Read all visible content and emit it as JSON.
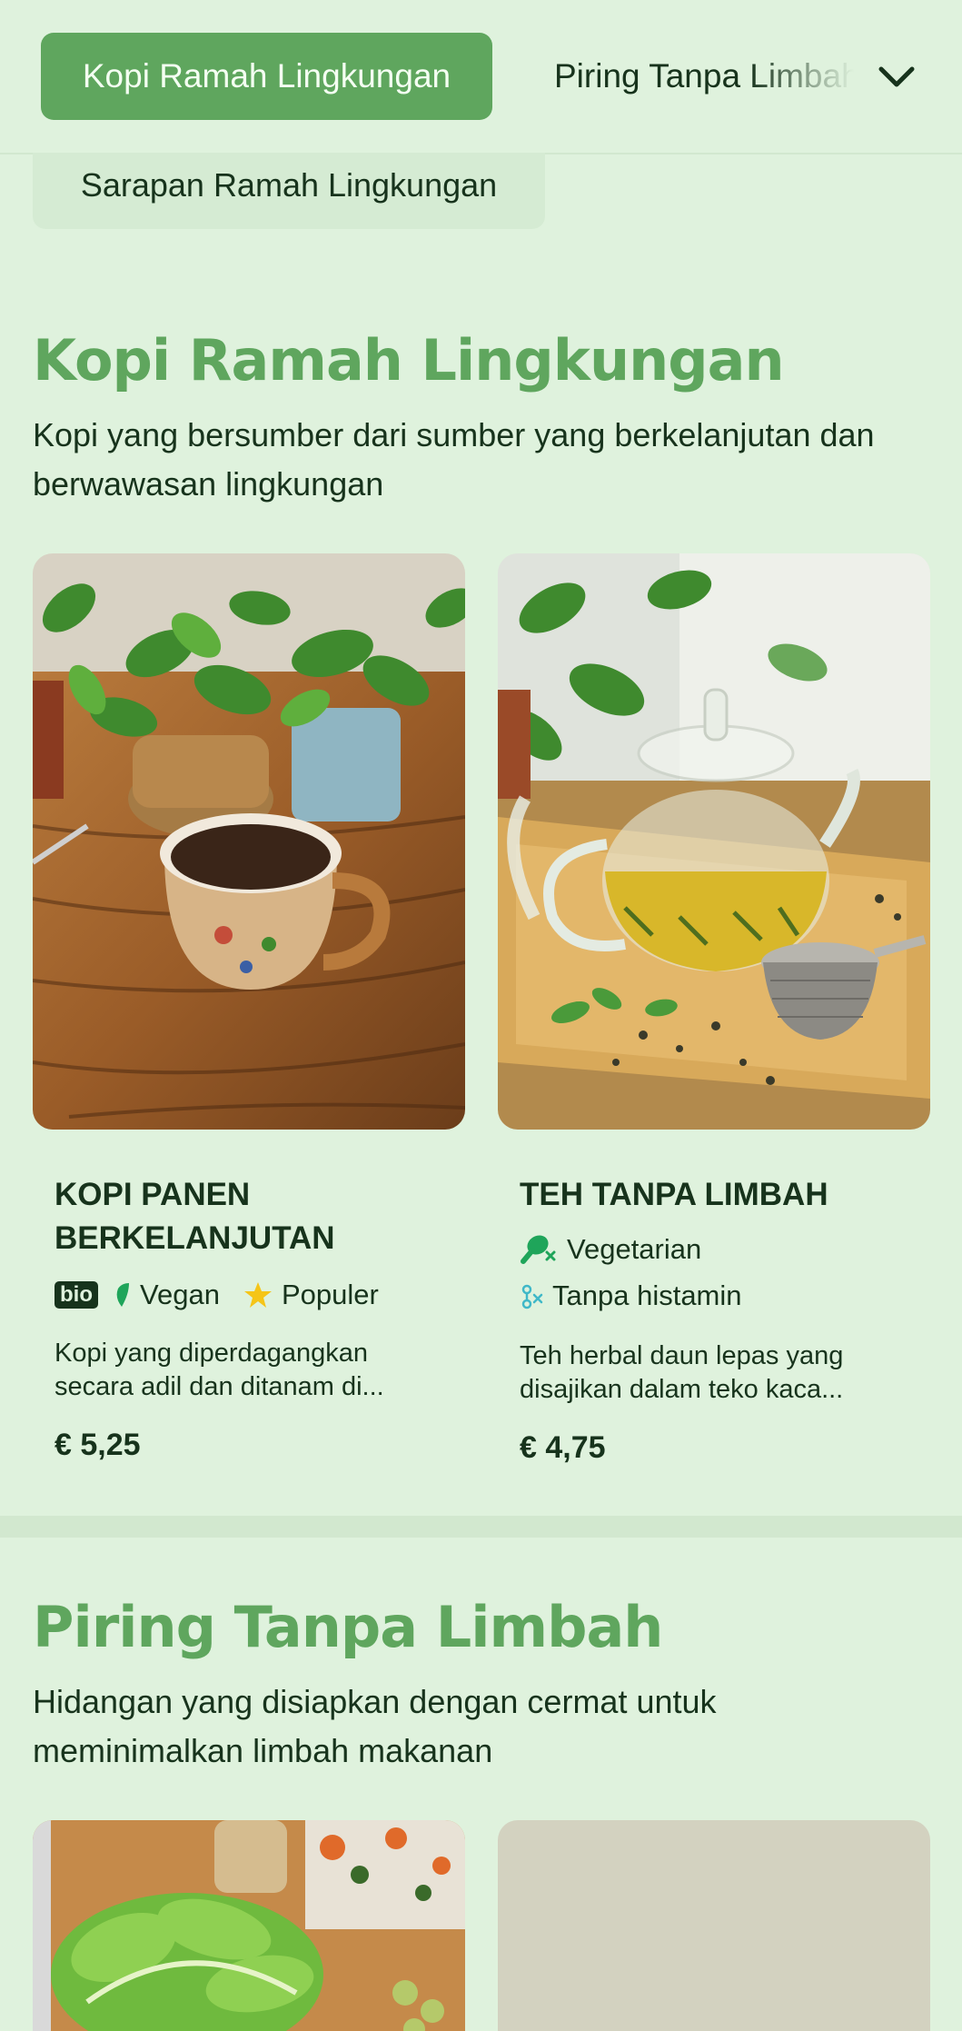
{
  "nav": {
    "active_category": "Kopi Ramah Lingkungan",
    "next_category": "Piring Tanpa Limbah",
    "sub_category": "Sarapan Ramah Lingkungan"
  },
  "sections": [
    {
      "title": "Kopi Ramah Lingkungan",
      "description": "Kopi yang bersumber dari sumber yang berkelanjutan dan berwawasan lingkungan",
      "items": [
        {
          "name": "KOPI PANEN BERKELANJUTAN",
          "badge": "bio",
          "tags": [
            "Vegan",
            "Populer"
          ],
          "description": "Kopi yang diperdagangkan secara adil dan ditanam di...",
          "price": "€ 5,25"
        },
        {
          "name": "TEH TANPA LIMBAH",
          "tags": [
            "Vegetarian",
            "Tanpa histamin"
          ],
          "description": "Teh herbal daun lepas yang disajikan dalam teko kaca...",
          "price": "€ 4,75"
        }
      ]
    },
    {
      "title": "Piring Tanpa Limbah",
      "description": "Hidangan yang disiapkan dengan cermat untuk meminimalkan limbah makanan"
    }
  ],
  "colors": {
    "background": "#dff2dd",
    "accent": "#5fa65e",
    "text": "#17331c",
    "vegan_icon": "#1fa55a",
    "star_icon": "#f5c518",
    "histamine_icon": "#3fb8c8"
  },
  "icons": {
    "dropdown": "chevron-down-icon",
    "vegan": "leaf-icon",
    "popular": "star-icon",
    "vegetarian": "drumstick-crossed-icon",
    "histamine_free": "molecule-icon"
  }
}
